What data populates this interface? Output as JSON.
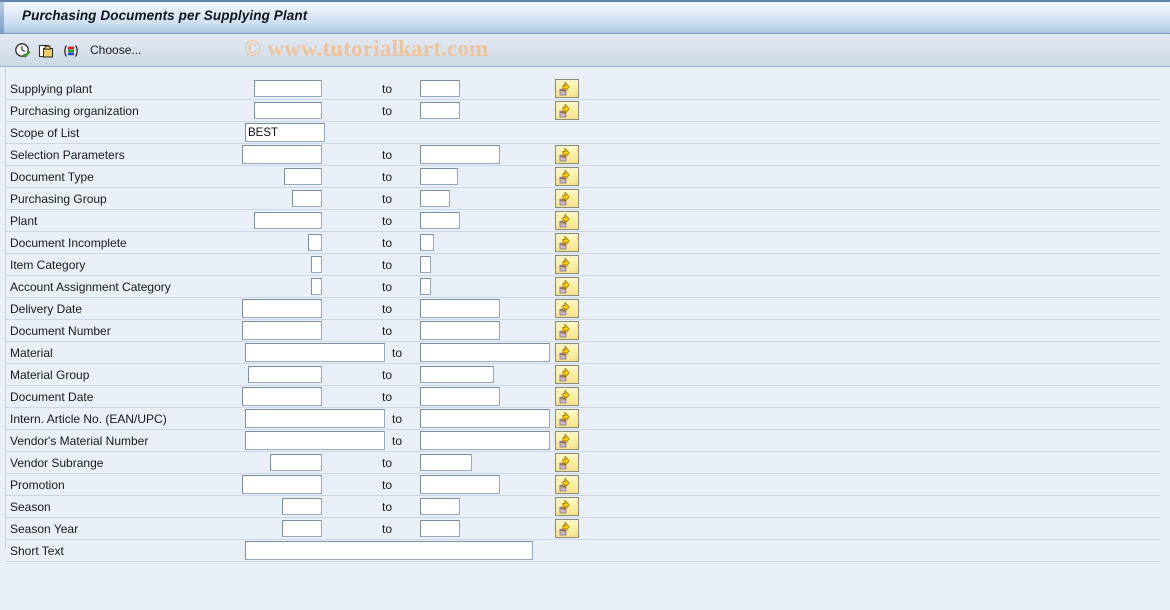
{
  "window": {
    "title": "Purchasing Documents per Supplying Plant"
  },
  "toolbar": {
    "icons": [
      {
        "name": "execute-clock-check-icon",
        "title": "Execute"
      },
      {
        "name": "copy-documents-icon",
        "title": "Copy"
      },
      {
        "name": "color-bars-variant-icon",
        "title": "Variant"
      }
    ],
    "choose_label": "Choose..."
  },
  "watermark": {
    "text": "© www.tutorialkart.com",
    "color": "#f0c49a"
  },
  "form": {
    "to_label": "to",
    "arrow_button_title": "Multiple selection",
    "rows": [
      {
        "label": "Supplying plant",
        "from": "",
        "to": "",
        "from_w": 68,
        "to_w": 40,
        "arrow": true
      },
      {
        "label": "Purchasing organization",
        "from": "",
        "to": "",
        "from_w": 68,
        "to_w": 40,
        "arrow": true
      },
      {
        "label": "Scope of List",
        "from": "BEST",
        "to": null,
        "from_w": 80,
        "to_w": 0,
        "arrow": false
      },
      {
        "label": "Selection Parameters",
        "from": "",
        "to": "",
        "from_w": 80,
        "to_w": 80,
        "arrow": true
      },
      {
        "label": "Document Type",
        "from": "",
        "to": "",
        "from_w": 38,
        "to_w": 38,
        "arrow": true
      },
      {
        "label": "Purchasing Group",
        "from": "",
        "to": "",
        "from_w": 30,
        "to_w": 30,
        "arrow": true
      },
      {
        "label": "Plant",
        "from": "",
        "to": "",
        "from_w": 68,
        "to_w": 40,
        "arrow": true
      },
      {
        "label": "Document Incomplete",
        "from": "",
        "to": "",
        "from_w": 14,
        "to_w": 14,
        "arrow": true
      },
      {
        "label": "Item Category",
        "from": "",
        "to": "",
        "from_w": 11,
        "to_w": 11,
        "arrow": true
      },
      {
        "label": "Account Assignment Category",
        "from": "",
        "to": "",
        "from_w": 11,
        "to_w": 11,
        "arrow": true
      },
      {
        "label": "Delivery Date",
        "from": "",
        "to": "",
        "from_w": 80,
        "to_w": 80,
        "arrow": true
      },
      {
        "label": "Document Number",
        "from": "",
        "to": "",
        "from_w": 80,
        "to_w": 80,
        "arrow": true
      },
      {
        "label": "Material",
        "from": "",
        "to": "",
        "from_w": 140,
        "to_w": 130,
        "arrow": true
      },
      {
        "label": "Material Group",
        "from": "",
        "to": "",
        "from_w": 74,
        "to_w": 74,
        "arrow": true
      },
      {
        "label": "Document Date",
        "from": "",
        "to": "",
        "from_w": 80,
        "to_w": 80,
        "arrow": true
      },
      {
        "label": "Intern. Article No. (EAN/UPC)",
        "from": "",
        "to": "",
        "from_w": 140,
        "to_w": 130,
        "arrow": true
      },
      {
        "label": "Vendor's Material Number",
        "from": "",
        "to": "",
        "from_w": 140,
        "to_w": 130,
        "arrow": true
      },
      {
        "label": "Vendor Subrange",
        "from": "",
        "to": "",
        "from_w": 52,
        "to_w": 52,
        "arrow": true
      },
      {
        "label": "Promotion",
        "from": "",
        "to": "",
        "from_w": 80,
        "to_w": 80,
        "arrow": true
      },
      {
        "label": "Season",
        "from": "",
        "to": "",
        "from_w": 40,
        "to_w": 40,
        "arrow": true
      },
      {
        "label": "Season Year",
        "from": "",
        "to": "",
        "from_w": 40,
        "to_w": 40,
        "arrow": true
      },
      {
        "label": "Short Text",
        "from": "",
        "to": null,
        "from_w": 288,
        "to_w": 0,
        "arrow": false
      }
    ]
  }
}
